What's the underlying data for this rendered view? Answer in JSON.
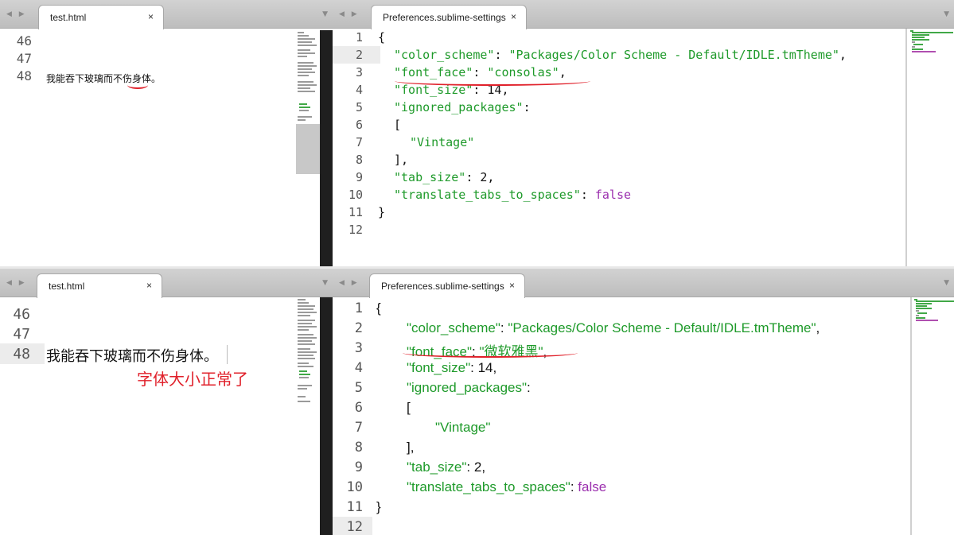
{
  "top": {
    "left_pane": {
      "tab_label": "test.html",
      "close_glyph": "×",
      "line_numbers": [
        "46",
        "47",
        "48"
      ],
      "line48_text": "我能吞下玻璃而不伤身体。"
    },
    "right_pane": {
      "tab_label": "Preferences.sublime-settings",
      "close_glyph": "×",
      "line_numbers": [
        "1",
        "2",
        "3",
        "4",
        "5",
        "6",
        "7",
        "8",
        "9",
        "10",
        "11",
        "12"
      ]
    }
  },
  "bottom": {
    "left_pane": {
      "tab_label": "test.html",
      "close_glyph": "×",
      "line_numbers": [
        "46",
        "47",
        "48"
      ],
      "line48_text": "我能吞下玻璃而不伤身体。",
      "annotation": "字体大小正常了"
    },
    "right_pane": {
      "tab_label": "Preferences.sublime-settings",
      "close_glyph": "×",
      "line_numbers": [
        "1",
        "2",
        "3",
        "4",
        "5",
        "6",
        "7",
        "8",
        "9",
        "10",
        "11",
        "12"
      ]
    }
  },
  "code": {
    "open_brace": "{",
    "close_brace": "}",
    "open_bracket": "[",
    "close_bracket": "],",
    "key_color_scheme": "\"color_scheme\"",
    "val_color_scheme": "\"Packages/Color Scheme - Default/IDLE.tmTheme\"",
    "key_font_face": "\"font_face\"",
    "val_font_face_top": "\"consolas\"",
    "val_font_face_bottom": "\"微软雅黑\"",
    "key_font_size": "\"font_size\"",
    "val_font_size": "14",
    "key_ignored": "\"ignored_packages\"",
    "val_vintage": "\"Vintage\"",
    "key_tab_size": "\"tab_size\"",
    "val_tab_size": "2",
    "key_translate": "\"translate_tabs_to_spaces\"",
    "val_translate": "false",
    "colon": ": ",
    "comma": ","
  },
  "nav_glyphs": {
    "left_right": "◀ ▶",
    "dropdown": "▼"
  },
  "colors": {
    "string": "#1e9a2a",
    "constant": "#9b2fae",
    "annotation": "#e0202a"
  }
}
